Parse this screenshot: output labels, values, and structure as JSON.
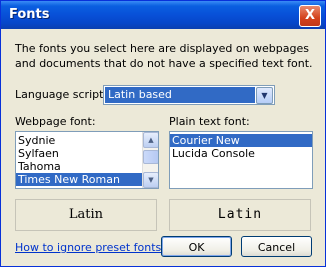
{
  "window": {
    "title": "Fonts",
    "close_glyph": "X"
  },
  "description": "The fonts you select here are displayed on webpages and documents that do not have a specified text font.",
  "language": {
    "label": "Language script:",
    "value": "Latin based"
  },
  "webpage_font": {
    "label": "Webpage font:",
    "items": [
      "Sydnie",
      "Sylfaen",
      "Tahoma",
      "Times New Roman"
    ],
    "selected": "Times New Roman"
  },
  "plain_font": {
    "label": "Plain text font:",
    "items": [
      "Courier New",
      "Lucida Console"
    ],
    "selected": "Courier New"
  },
  "preview": {
    "webpage": "Latin",
    "plain": "Latin"
  },
  "link": "How to ignore preset fonts",
  "buttons": {
    "ok": "OK",
    "cancel": "Cancel"
  },
  "icons": {
    "dropdown": "chevron-down-icon",
    "scroll_up": "chevron-up-icon",
    "scroll_down": "chevron-down-icon"
  },
  "colors": {
    "titlebar": "#0a5fe0",
    "selection": "#316ac5",
    "link": "#0033cc",
    "close": "#d4421c"
  }
}
